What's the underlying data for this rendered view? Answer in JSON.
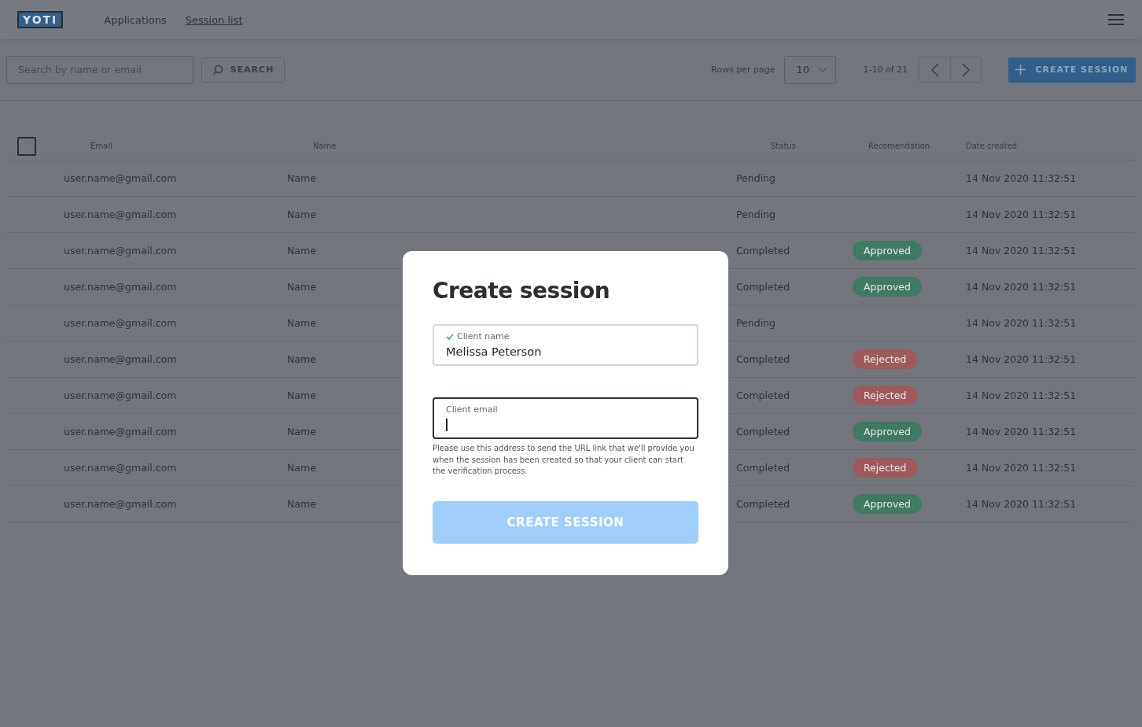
{
  "header": {
    "logo": "YOTI",
    "nav": [
      {
        "label": "Applications",
        "selected": false
      },
      {
        "label": "Session list",
        "selected": true
      }
    ]
  },
  "toolbar": {
    "search": {
      "placeholder": "Search by name or email"
    },
    "search_button": "SEARCH",
    "rows_per_page_label": "Rows per page",
    "rows_per_page": "10",
    "range": "1-10 of 21",
    "create_button": "CREATE SESSION"
  },
  "table": {
    "select_all_checked": false,
    "columns": [
      "Email",
      "Name",
      "Status",
      "Recomendation",
      "Date created"
    ],
    "rows": [
      {
        "email": "user.name@gmail.com",
        "name": "Name",
        "status": "Pending",
        "date": "14 Nov 2020 11:32:51"
      },
      {
        "email": "user.name@gmail.com",
        "name": "Name",
        "status": "Pending",
        "date": "14 Nov 2020 11:32:51"
      },
      {
        "email": "user.name@gmail.com",
        "name": "Name",
        "status": "Completed",
        "recommendation": {
          "label": "Approved",
          "color": "#3f7a62"
        },
        "date": "14 Nov 2020 11:32:51"
      },
      {
        "email": "user.name@gmail.com",
        "name": "Name",
        "status": "Completed",
        "recommendation": {
          "label": "Approved",
          "color": "#3f7a62"
        },
        "date": "14 Nov 2020 11:32:51"
      },
      {
        "email": "user.name@gmail.com",
        "name": "Name",
        "status": "Pending",
        "date": "14 Nov 2020 11:32:51"
      },
      {
        "email": "user.name@gmail.com",
        "name": "Name",
        "status": "Completed",
        "recommendation": {
          "label": "Rejected",
          "color": "#a05a5c"
        },
        "date": "14 Nov 2020 11:32:51"
      },
      {
        "email": "user.name@gmail.com",
        "name": "Name",
        "status": "Completed",
        "recommendation": {
          "label": "Rejected",
          "color": "#a05a5c"
        },
        "date": "14 Nov 2020 11:32:51"
      },
      {
        "email": "user.name@gmail.com",
        "name": "Name",
        "status": "Completed",
        "recommendation": {
          "label": "Approved",
          "color": "#3f7a62"
        },
        "date": "14 Nov 2020 11:32:51"
      },
      {
        "email": "user.name@gmail.com",
        "name": "Name",
        "status": "Completed",
        "recommendation": {
          "label": "Rejected",
          "color": "#a05a5c"
        },
        "date": "14 Nov 2020 11:32:51"
      },
      {
        "email": "user.name@gmail.com",
        "name": "Name",
        "status": "Completed",
        "recommendation": {
          "label": "Approved",
          "color": "#3f7a62"
        },
        "date": "14 Nov 2020 11:32:51"
      }
    ]
  },
  "dialog": {
    "title": "Create session",
    "fields": [
      {
        "label": "Client name",
        "value": "Melissa Peterson",
        "valid": true,
        "focused": false
      },
      {
        "label": "Client email",
        "valid": false,
        "focused": true
      }
    ],
    "hint": "Please use this address to send the URL link that we'll provide you when the session has been created so that your client can start the verification process.",
    "submit": "CREATE SESSION",
    "submit_disabled": true
  }
}
